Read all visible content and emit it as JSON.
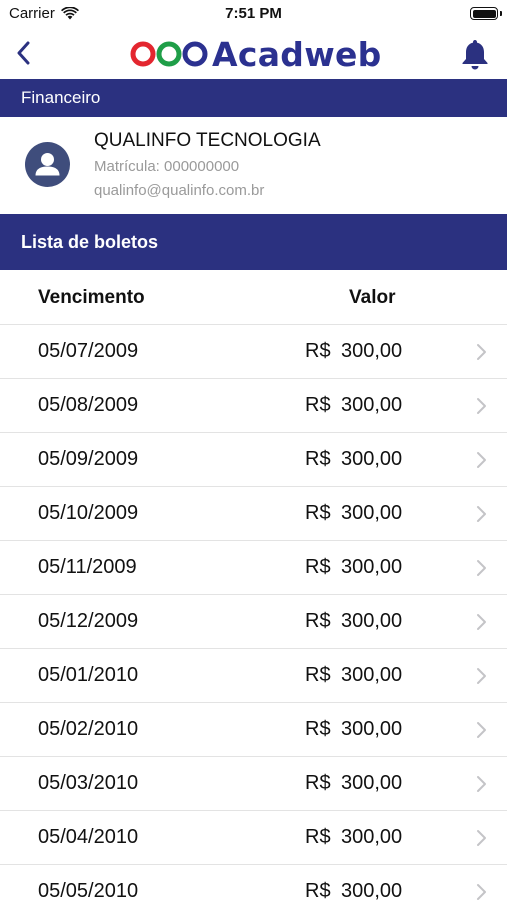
{
  "status_bar": {
    "carrier": "Carrier",
    "time": "7:51 PM"
  },
  "nav": {
    "logo_text": "Acadweb",
    "logo_ring_colors": [
      "#e3262f",
      "#1f9e48",
      "#2b3190"
    ]
  },
  "section": {
    "title": "Financeiro"
  },
  "profile": {
    "name": "QUALINFO TECNOLOGIA",
    "matricula": "Matrícula: 000000000",
    "email": "qualinfo@qualinfo.com.br"
  },
  "list": {
    "title": "Lista de boletos",
    "columns": {
      "due": "Vencimento",
      "value": "Valor"
    },
    "rows": [
      {
        "date": "05/07/2009",
        "currency": "R$",
        "amount": "300,00"
      },
      {
        "date": "05/08/2009",
        "currency": "R$",
        "amount": "300,00"
      },
      {
        "date": "05/09/2009",
        "currency": "R$",
        "amount": "300,00"
      },
      {
        "date": "05/10/2009",
        "currency": "R$",
        "amount": "300,00"
      },
      {
        "date": "05/11/2009",
        "currency": "R$",
        "amount": "300,00"
      },
      {
        "date": "05/12/2009",
        "currency": "R$",
        "amount": "300,00"
      },
      {
        "date": "05/01/2010",
        "currency": "R$",
        "amount": "300,00"
      },
      {
        "date": "05/02/2010",
        "currency": "R$",
        "amount": "300,00"
      },
      {
        "date": "05/03/2010",
        "currency": "R$",
        "amount": "300,00"
      },
      {
        "date": "05/04/2010",
        "currency": "R$",
        "amount": "300,00"
      },
      {
        "date": "05/05/2010",
        "currency": "R$",
        "amount": "300,00"
      }
    ]
  },
  "colors": {
    "brand": "#2b3180",
    "separator": "#e3e3e3",
    "muted_text": "#9a9a9a",
    "chevron": "#c4c4c7"
  },
  "icons": {
    "back": "chevron-left-icon",
    "notifications": "bell-icon",
    "avatar": "user-silhouette-icon",
    "row_disclosure": "chevron-right-icon",
    "wifi": "wifi-icon",
    "battery": "battery-icon"
  }
}
